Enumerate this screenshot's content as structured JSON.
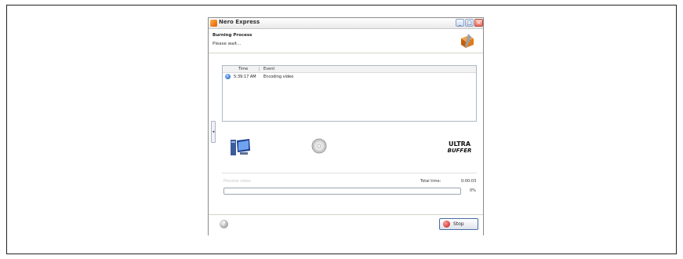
{
  "window": {
    "title": "Nero Express"
  },
  "header": {
    "title": "Burning Process",
    "subtitle": "Please wait..."
  },
  "log": {
    "columns": [
      "Time",
      "Event"
    ],
    "rows": [
      {
        "icon": "info-icon",
        "time": "5:39:17 AM",
        "event": "Encoding video"
      }
    ]
  },
  "branding": {
    "ultra_line1": "ULTRA",
    "ultra_line2": "BUFFER"
  },
  "progress": {
    "preview_label": "Preview video",
    "total_time_label": "Total time:",
    "total_time_value": "0:00:03",
    "percent_label": "0%",
    "fraction": 0
  },
  "footer": {
    "help_label": "?",
    "stop_label": "Stop"
  },
  "colors": {
    "accent": "#e55b00",
    "progress": "#4bbf4b"
  }
}
